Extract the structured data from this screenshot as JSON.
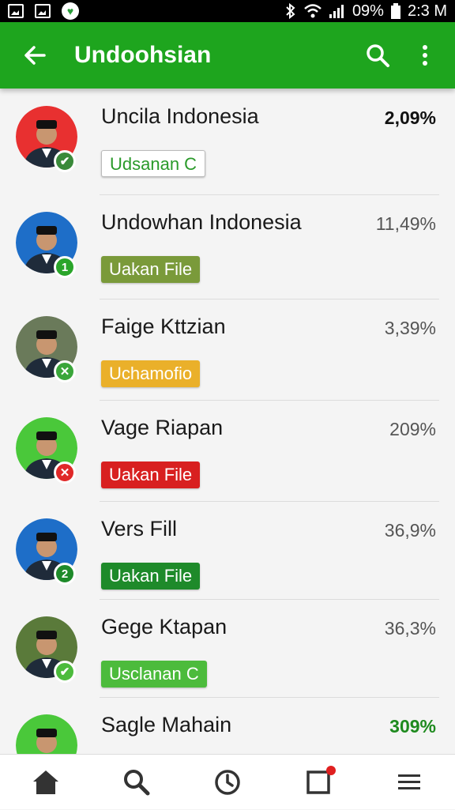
{
  "status_bar": {
    "battery": "09%",
    "time": "2:3 M"
  },
  "app_bar": {
    "title": "Undoohsian"
  },
  "items": [
    {
      "name": "Uncila Indonesia",
      "tag": "Udsanan C",
      "tag_color": "#ffffff",
      "tag_style": "outline",
      "percent": "2,09%",
      "percent_style": "bold",
      "badge": "✔",
      "badge_color": "#3a8a3a",
      "avatar_bg": "#e83030"
    },
    {
      "name": "Undowhan Indonesia",
      "tag": "Uakan File",
      "tag_color": "#7a9a3a",
      "tag_style": "filled",
      "percent": "11,49%",
      "percent_style": "normal",
      "badge": "1",
      "badge_color": "#2aa52a",
      "avatar_bg": "#1e6ec8"
    },
    {
      "name": "Faige Kttzian",
      "tag": "Uchamofio",
      "tag_color": "#eab02a",
      "tag_style": "filled",
      "percent": "3,39%",
      "percent_style": "normal",
      "badge": "✕",
      "badge_color": "#3aa63a",
      "avatar_bg": "#6a7a5a"
    },
    {
      "name": "Vage Riapan",
      "tag": "Uakan File",
      "tag_color": "#d82020",
      "tag_style": "filled",
      "percent": "209%",
      "percent_style": "normal",
      "badge": "✕",
      "badge_color": "#e02828",
      "avatar_bg": "#4ac83a"
    },
    {
      "name": "Vers Fill",
      "tag": "Uakan File",
      "tag_color": "#1e8a2a",
      "tag_style": "filled",
      "percent": "36,9%",
      "percent_style": "normal",
      "badge": "2",
      "badge_color": "#1e8a2a",
      "avatar_bg": "#1e6ec8"
    },
    {
      "name": "Gege Ktapan",
      "tag": "Usclanan C",
      "tag_color": "#4cbb3c",
      "tag_style": "filled",
      "percent": "36,3%",
      "percent_style": "normal",
      "badge": "✔",
      "badge_color": "#4cbb3c",
      "avatar_bg": "#5a7a3a"
    },
    {
      "name": "Sagle Mahain",
      "tag": "",
      "tag_color": "#eab02a",
      "tag_style": "filled",
      "percent": "309%",
      "percent_style": "green",
      "badge": "",
      "badge_color": "#2aa52a",
      "avatar_bg": "#4ac83a"
    }
  ],
  "bottom_nav": [
    {
      "icon": "home-icon"
    },
    {
      "icon": "search-icon"
    },
    {
      "icon": "clock-icon"
    },
    {
      "icon": "square-icon",
      "has_notification": true
    },
    {
      "icon": "menu-icon"
    }
  ],
  "colors": {
    "brand_green": "#1ea51e",
    "notification_red": "#e02020"
  }
}
